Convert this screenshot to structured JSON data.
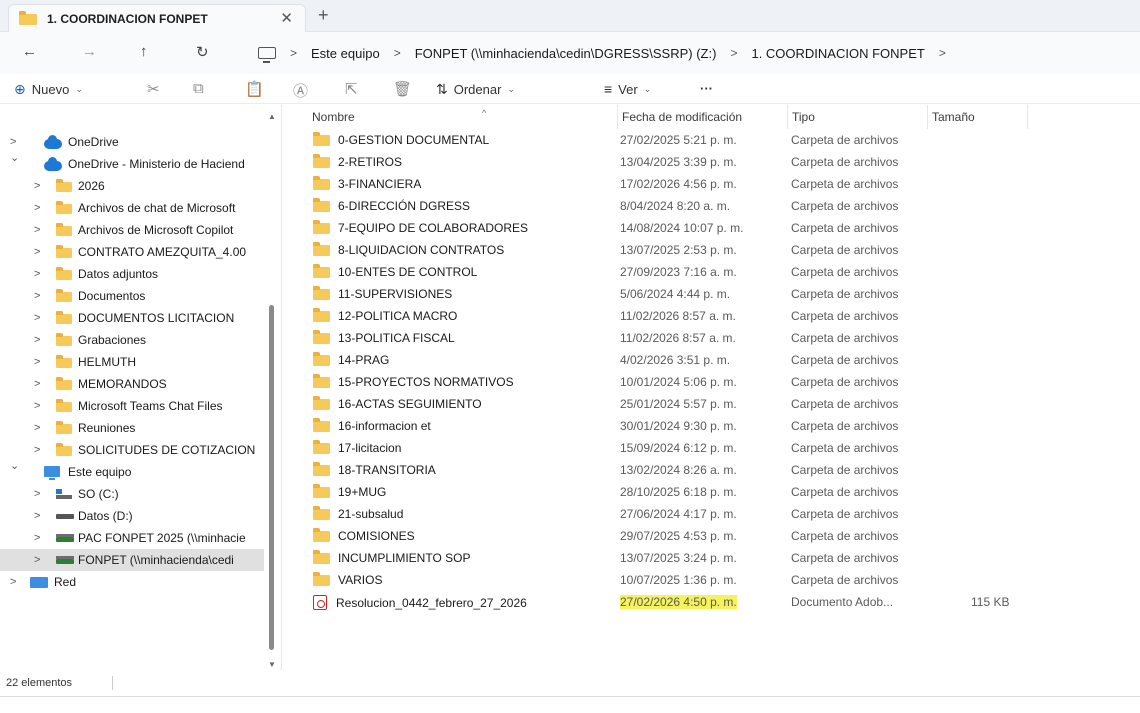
{
  "tab": {
    "title": "1. COORDINACION FONPET",
    "close": "✕",
    "new": "+"
  },
  "nav": {
    "back": "←",
    "forward": "→",
    "up": "↑",
    "refresh": "↻"
  },
  "breadcrumb": [
    "Este equipo",
    "FONPET (\\\\minhacienda\\cedin\\DGRESS\\SSRP) (Z:)",
    "1. COORDINACION FONPET"
  ],
  "toolbar": {
    "new_label": "Nuevo",
    "sort_label": "Ordenar",
    "view_label": "Ver",
    "more_label": "···"
  },
  "sidebar": {
    "items": [
      {
        "label": "OneDrive",
        "icon": "onedrive-icon",
        "caret": ">"
      },
      {
        "label": "OneDrive - Ministerio de Haciend",
        "icon": "onedrive-icon",
        "caret": "⌄"
      },
      {
        "label": "2026",
        "icon": "folder-icon",
        "caret": ">"
      },
      {
        "label": "Archivos de chat de Microsoft",
        "icon": "folder-icon",
        "caret": ">"
      },
      {
        "label": "Archivos de Microsoft Copilot",
        "icon": "folder-icon",
        "caret": ">"
      },
      {
        "label": "CONTRATO AMEZQUITA_4.00",
        "icon": "folder-icon",
        "caret": ">"
      },
      {
        "label": "Datos adjuntos",
        "icon": "folder-icon",
        "caret": ">"
      },
      {
        "label": "Documentos",
        "icon": "folder-icon",
        "caret": ">"
      },
      {
        "label": "DOCUMENTOS LICITACION",
        "icon": "folder-icon",
        "caret": ">"
      },
      {
        "label": "Grabaciones",
        "icon": "folder-icon",
        "caret": ">"
      },
      {
        "label": "HELMUTH",
        "icon": "folder-icon",
        "caret": ">"
      },
      {
        "label": "MEMORANDOS",
        "icon": "folder-icon",
        "caret": ">"
      },
      {
        "label": "Microsoft Teams Chat Files",
        "icon": "folder-icon",
        "caret": ">"
      },
      {
        "label": "Reuniones",
        "icon": "folder-icon",
        "caret": ">"
      },
      {
        "label": "SOLICITUDES DE COTIZACION",
        "icon": "folder-icon",
        "caret": ">"
      },
      {
        "label": "Este equipo",
        "icon": "pc-icon",
        "caret": "⌄"
      },
      {
        "label": "SO (C:)",
        "icon": "os-drive-icon",
        "caret": ">"
      },
      {
        "label": "Datos (D:)",
        "icon": "drive-icon",
        "caret": ">"
      },
      {
        "label": "PAC FONPET 2025 (\\\\minhacie",
        "icon": "network-drive-icon",
        "caret": ">"
      },
      {
        "label": "FONPET (\\\\minhacienda\\cedi",
        "icon": "network-drive-icon",
        "caret": ">"
      },
      {
        "label": "Red",
        "icon": "network-icon",
        "caret": ">"
      }
    ]
  },
  "columns": {
    "name": "Nombre",
    "date": "Fecha de modificación",
    "type": "Tipo",
    "size": "Tamaño"
  },
  "files": [
    {
      "name": "0-GESTION DOCUMENTAL",
      "date": "27/02/2025 5:21 p. m.",
      "type": "Carpeta de archivos",
      "size": ""
    },
    {
      "name": "2-RETIROS",
      "date": "13/04/2025 3:39 p. m.",
      "type": "Carpeta de archivos",
      "size": ""
    },
    {
      "name": "3-FINANCIERA",
      "date": "17/02/2026 4:56 p. m.",
      "type": "Carpeta de archivos",
      "size": ""
    },
    {
      "name": "6-DIRECCIÓN DGRESS",
      "date": "8/04/2024 8:20 a. m.",
      "type": "Carpeta de archivos",
      "size": ""
    },
    {
      "name": "7-EQUIPO DE COLABORADORES",
      "date": "14/08/2024 10:07 p. m.",
      "type": "Carpeta de archivos",
      "size": ""
    },
    {
      "name": "8-LIQUIDACION CONTRATOS",
      "date": "13/07/2025 2:53 p. m.",
      "type": "Carpeta de archivos",
      "size": ""
    },
    {
      "name": "10-ENTES DE CONTROL",
      "date": "27/09/2023 7:16 a. m.",
      "type": "Carpeta de archivos",
      "size": ""
    },
    {
      "name": "11-SUPERVISIONES",
      "date": "5/06/2024 4:44 p. m.",
      "type": "Carpeta de archivos",
      "size": ""
    },
    {
      "name": "12-POLITICA MACRO",
      "date": "11/02/2026 8:57 a. m.",
      "type": "Carpeta de archivos",
      "size": ""
    },
    {
      "name": "13-POLITICA FISCAL",
      "date": "11/02/2026 8:57 a. m.",
      "type": "Carpeta de archivos",
      "size": ""
    },
    {
      "name": "14-PRAG",
      "date": "4/02/2026 3:51 p. m.",
      "type": "Carpeta de archivos",
      "size": ""
    },
    {
      "name": "15-PROYECTOS NORMATIVOS",
      "date": "10/01/2024 5:06 p. m.",
      "type": "Carpeta de archivos",
      "size": ""
    },
    {
      "name": "16-ACTAS SEGUIMIENTO",
      "date": "25/01/2024 5:57 p. m.",
      "type": "Carpeta de archivos",
      "size": ""
    },
    {
      "name": "16-informacion et",
      "date": "30/01/2024 9:30 p. m.",
      "type": "Carpeta de archivos",
      "size": ""
    },
    {
      "name": "17-licitacion",
      "date": "15/09/2024 6:12 p. m.",
      "type": "Carpeta de archivos",
      "size": ""
    },
    {
      "name": "18-TRANSITORIA",
      "date": "13/02/2024 8:26 a. m.",
      "type": "Carpeta de archivos",
      "size": ""
    },
    {
      "name": "19+MUG",
      "date": "28/10/2025 6:18 p. m.",
      "type": "Carpeta de archivos",
      "size": ""
    },
    {
      "name": "21-subsalud",
      "date": "27/06/2024 4:17 p. m.",
      "type": "Carpeta de archivos",
      "size": ""
    },
    {
      "name": "COMISIONES",
      "date": "29/07/2025 4:53 p. m.",
      "type": "Carpeta de archivos",
      "size": ""
    },
    {
      "name": "INCUMPLIMIENTO SOP",
      "date": "13/07/2025 3:24 p. m.",
      "type": "Carpeta de archivos",
      "size": ""
    },
    {
      "name": "VARIOS",
      "date": "10/07/2025 1:36 p. m.",
      "type": "Carpeta de archivos",
      "size": ""
    },
    {
      "name": "Resolucion_0442_febrero_27_2026",
      "date": "27/02/2026 4:50 p. m.",
      "type": "Documento Adob...",
      "size": "115 KB",
      "icon": "pdf-icon",
      "highlight": true
    }
  ],
  "status": {
    "count": "22 elementos"
  },
  "colors": {
    "folder": "#f6c95b",
    "highlight": "#f5f25b",
    "selected_nav": "#e0e0e0",
    "accent": "#1a5fb4"
  }
}
